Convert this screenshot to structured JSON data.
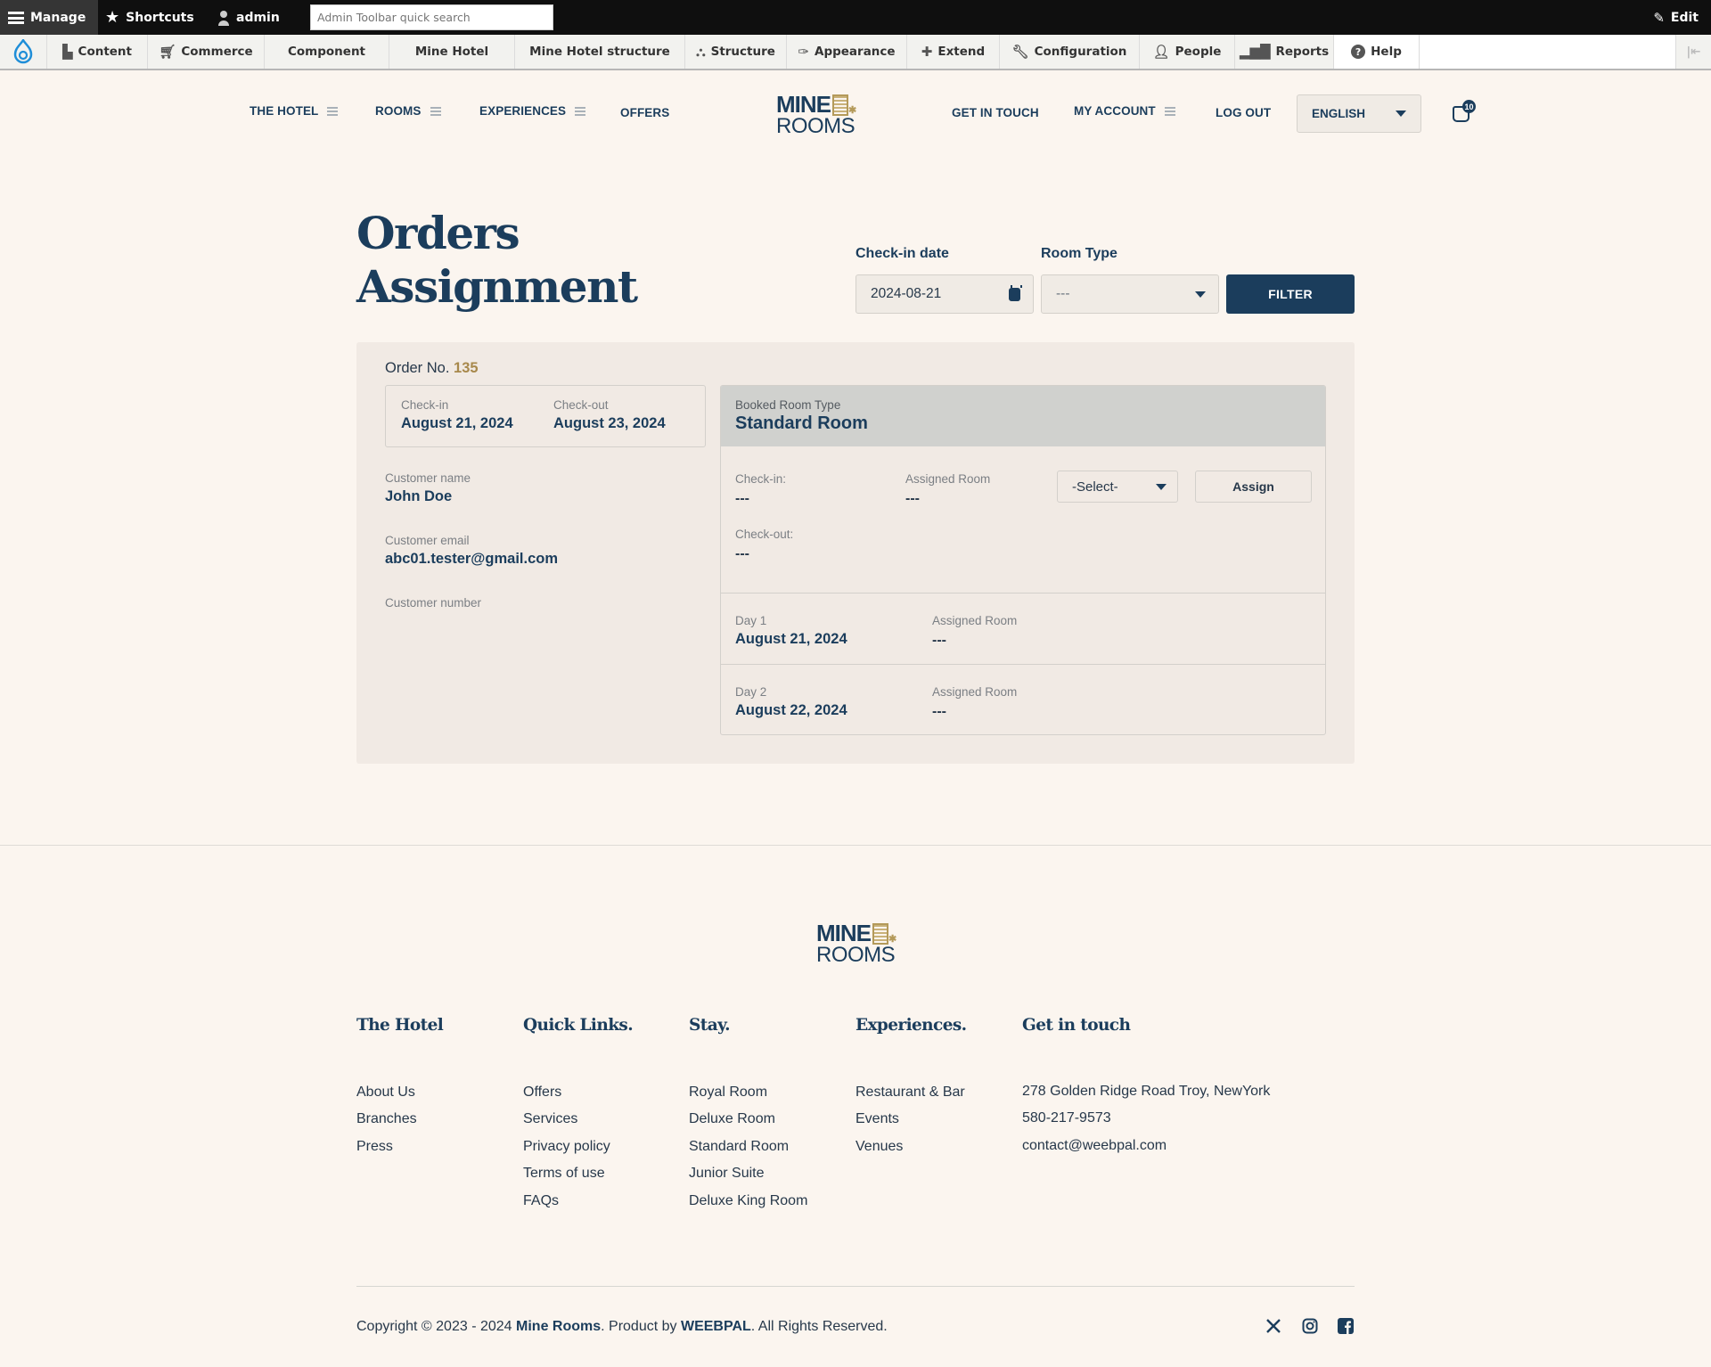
{
  "admin_toolbar": {
    "manage": "Manage",
    "shortcuts": "Shortcuts",
    "user": "admin",
    "search_placeholder": "Admin Toolbar quick search",
    "edit": "Edit",
    "menu": [
      {
        "label": "Content",
        "icon": "file-icon"
      },
      {
        "label": "Commerce",
        "icon": "cart-icon"
      },
      {
        "label": "Component",
        "icon": ""
      },
      {
        "label": "Mine Hotel",
        "icon": ""
      },
      {
        "label": "Mine Hotel structure",
        "icon": ""
      },
      {
        "label": "Structure",
        "icon": "sitemap-icon"
      },
      {
        "label": "Appearance",
        "icon": "paintbrush-icon"
      },
      {
        "label": "Extend",
        "icon": "puzzle-icon"
      },
      {
        "label": "Configuration",
        "icon": "wrench-icon"
      },
      {
        "label": "People",
        "icon": "people-icon"
      },
      {
        "label": "Reports",
        "icon": "bar-chart-icon"
      },
      {
        "label": "Help",
        "icon": "help-icon"
      }
    ]
  },
  "header": {
    "nav_left": [
      "THE HOTEL",
      "ROOMS",
      "EXPERIENCES",
      "OFFERS"
    ],
    "logo_top": "MINE",
    "logo_bottom": "ROOMS",
    "nav_right": [
      "GET IN TOUCH",
      "MY ACCOUNT",
      "LOG OUT"
    ],
    "language": "ENGLISH",
    "cart_count": "10"
  },
  "page": {
    "title_line1": "Orders",
    "title_line2": "Assignment",
    "filter": {
      "checkin_label": "Check-in date",
      "checkin_value": "2024-08-21",
      "room_type_label": "Room Type",
      "room_type_value": "---",
      "button": "FILTER"
    }
  },
  "order": {
    "order_label": "Order No.",
    "order_number": "135",
    "checkin_label": "Check-in",
    "checkin_date": "August 21, 2024",
    "checkout_label": "Check-out",
    "checkout_date": "August 23, 2024",
    "customer_name_label": "Customer name",
    "customer_name": "John Doe",
    "customer_email_label": "Customer email",
    "customer_email": "abc01.tester@gmail.com",
    "customer_number_label": "Customer number",
    "booked_room_type_label": "Booked Room Type",
    "booked_room_type": "Standard Room",
    "assign_block": {
      "checkin_label": "Check-in:",
      "checkin_value": "---",
      "assigned_room_label": "Assigned Room",
      "assigned_room_value": "---",
      "checkout_label": "Check-out:",
      "checkout_value": "---",
      "select_value": "-Select-",
      "assign_button": "Assign"
    },
    "days": [
      {
        "label": "Day 1",
        "date": "August 21, 2024",
        "assigned_label": "Assigned Room",
        "assigned_value": "---"
      },
      {
        "label": "Day 2",
        "date": "August 22, 2024",
        "assigned_label": "Assigned Room",
        "assigned_value": "---"
      }
    ]
  },
  "footer": {
    "logo_top": "MINE",
    "logo_bottom": "ROOMS",
    "columns": [
      {
        "heading": "The Hotel",
        "links": [
          "About Us",
          "Branches",
          "Press"
        ]
      },
      {
        "heading": "Quick Links.",
        "links": [
          "Offers",
          "Services",
          "Privacy policy",
          "Terms of use",
          "FAQs"
        ]
      },
      {
        "heading": "Stay.",
        "links": [
          "Royal Room",
          "Deluxe Room",
          "Standard Room",
          "Junior Suite",
          "Deluxe King Room"
        ]
      },
      {
        "heading": "Experiences.",
        "links": [
          "Restaurant & Bar",
          "Events",
          "Venues"
        ]
      },
      {
        "heading": "Get in touch",
        "links": [
          "278 Golden Ridge Road Troy, NewYork",
          "580-217-9573",
          "contact@weebpal.com"
        ]
      }
    ],
    "copyright_prefix": "Copyright © 2023 - 2024 ",
    "brand": "Mine Rooms",
    "product_by": ". Product by ",
    "vendor": "WEEBPAL",
    "rights": ". All Rights Reserved.",
    "social": [
      "x-icon",
      "instagram-icon",
      "facebook-icon"
    ]
  },
  "colors": {
    "primary": "#1b3d5c",
    "accent_gold": "#a8894c",
    "page_bg": "#fbf5ef",
    "card_bg": "#f1eae4"
  }
}
